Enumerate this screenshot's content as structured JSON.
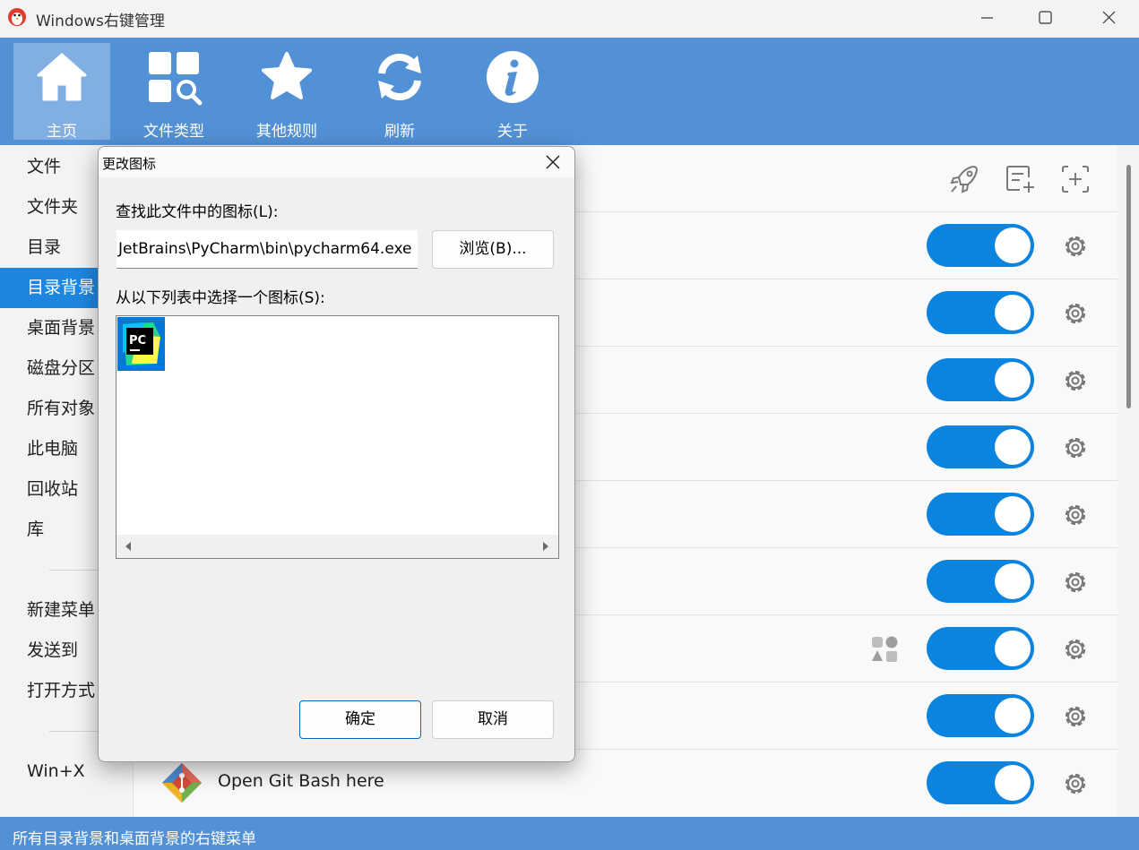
{
  "window": {
    "title": "Windows右键管理",
    "icon": "app-icon"
  },
  "toolbar": {
    "items": [
      {
        "label": "主页",
        "icon": "home-icon",
        "active": true
      },
      {
        "label": "文件类型",
        "icon": "filetype-search-icon",
        "active": false
      },
      {
        "label": "其他规则",
        "icon": "star-icon",
        "active": false
      },
      {
        "label": "刷新",
        "icon": "refresh-icon",
        "active": false
      },
      {
        "label": "关于",
        "icon": "info-icon",
        "active": false
      }
    ]
  },
  "sidebar": {
    "items": [
      {
        "label": "文件"
      },
      {
        "label": "文件夹"
      },
      {
        "label": "目录"
      },
      {
        "label": "目录背景",
        "active": true
      },
      {
        "label": "桌面背景"
      },
      {
        "label": "磁盘分区"
      },
      {
        "label": "所有对象"
      },
      {
        "label": "此电脑"
      },
      {
        "label": "回收站"
      },
      {
        "label": "库"
      },
      {
        "label": "新建菜单"
      },
      {
        "label": "发送到"
      },
      {
        "label": "打开方式"
      },
      {
        "label": "Win+X"
      }
    ]
  },
  "main": {
    "header_icons": [
      "rocket-icon",
      "add-note-icon",
      "add-target-icon"
    ],
    "rows": [
      {
        "label": "",
        "enabled": true
      },
      {
        "label": "",
        "enabled": true
      },
      {
        "label": "",
        "enabled": true
      },
      {
        "label": "",
        "enabled": true
      },
      {
        "label": "",
        "enabled": true
      },
      {
        "label": "",
        "enabled": true
      },
      {
        "label": "",
        "enabled": true
      },
      {
        "label": "",
        "enabled": true
      },
      {
        "label": "Open Git Bash here",
        "enabled": true,
        "icon": "git-icon"
      }
    ]
  },
  "dialog": {
    "title": "更改图标",
    "find_label": "查找此文件中的图标(L):",
    "path_value": "JetBrains\\PyCharm\\bin\\pycharm64.exe",
    "browse_label": "浏览(B)...",
    "list_label": "从以下列表中选择一个图标(S):",
    "icons": [
      {
        "name": "pycharm-icon",
        "text": "PC"
      }
    ],
    "ok_label": "确定",
    "cancel_label": "取消"
  },
  "statusbar": {
    "text": "所有目录背景和桌面背景的右键菜单"
  },
  "colors": {
    "toolbar": "#5391d6",
    "accent": "#1e86df",
    "toggle_on": "#0b84e0"
  }
}
